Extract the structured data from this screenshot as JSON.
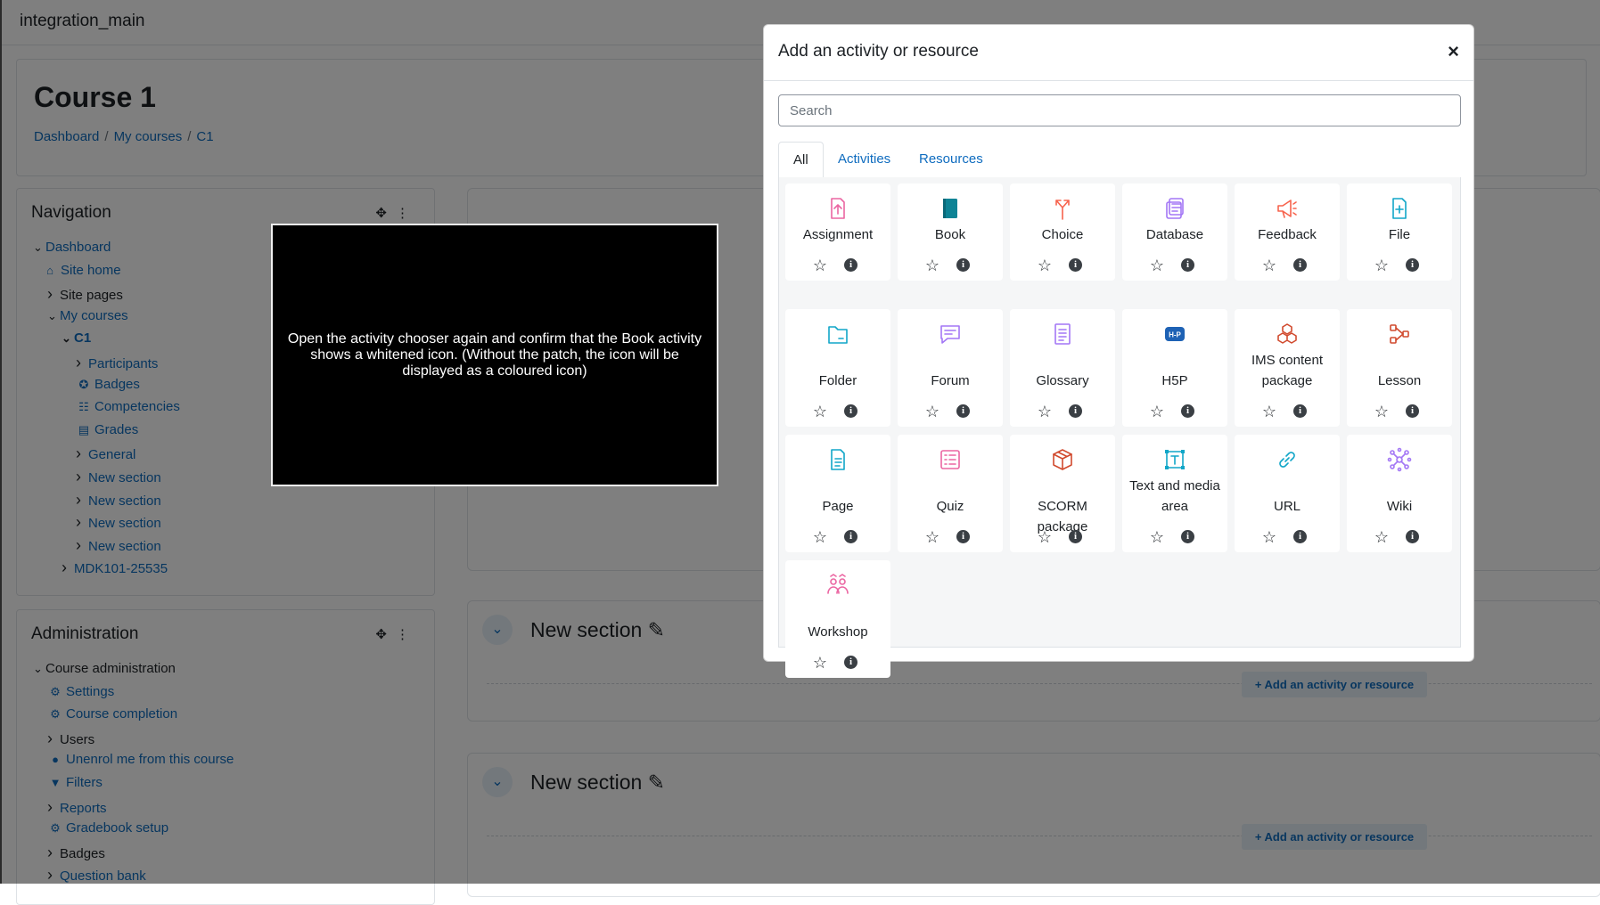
{
  "site": {
    "name": "integration_main"
  },
  "course": {
    "title": "Course 1",
    "breadcrumb": [
      "Dashboard",
      "My courses",
      "C1"
    ]
  },
  "navigation": {
    "title": "Navigation",
    "items": [
      {
        "label": "Dashboard",
        "icon": "chevron-down-icon"
      },
      {
        "label": "Site home",
        "icon": "home-icon"
      },
      {
        "label": "Site pages",
        "icon": "chevron-right-icon"
      },
      {
        "label": "My courses",
        "icon": "chevron-down-icon"
      },
      {
        "label": "C1",
        "icon": "chevron-down-icon"
      },
      {
        "label": "Participants",
        "icon": "chevron-right-icon"
      },
      {
        "label": "Badges",
        "icon": "badge-icon"
      },
      {
        "label": "Competencies",
        "icon": "list-check-icon"
      },
      {
        "label": "Grades",
        "icon": "clipboard-icon"
      },
      {
        "label": "General",
        "icon": "chevron-right-icon"
      },
      {
        "label": "New section",
        "icon": "chevron-right-icon"
      },
      {
        "label": "New section",
        "icon": "chevron-right-icon"
      },
      {
        "label": "New section",
        "icon": "chevron-right-icon"
      },
      {
        "label": "New section",
        "icon": "chevron-right-icon"
      },
      {
        "label": "MDK101-25535",
        "icon": "chevron-right-icon"
      }
    ]
  },
  "administration": {
    "title": "Administration",
    "items": [
      {
        "label": "Course administration",
        "icon": "chevron-down-icon"
      },
      {
        "label": "Settings",
        "icon": "gear-icon"
      },
      {
        "label": "Course completion",
        "icon": "gear-icon"
      },
      {
        "label": "Users",
        "icon": "chevron-right-icon"
      },
      {
        "label": "Unenrol me from this course",
        "icon": "user-icon"
      },
      {
        "label": "Filters",
        "icon": "filter-icon"
      },
      {
        "label": "Reports",
        "icon": "chevron-right-icon"
      },
      {
        "label": "Gradebook setup",
        "icon": "gear-icon"
      },
      {
        "label": "Badges",
        "icon": "chevron-right-icon"
      },
      {
        "label": "Question bank",
        "icon": "chevron-right-icon"
      }
    ]
  },
  "sections": [
    {
      "title": "New section",
      "add_label": "Add an activity or resource"
    },
    {
      "title": "New section",
      "add_label": "Add an activity or resource"
    }
  ],
  "instruction": {
    "text": "Open the activity chooser again and confirm that the Book activity shows a whitened icon. (Without the patch, the icon will be displayed as a coloured icon)"
  },
  "modal": {
    "title": "Add an activity or resource",
    "close_label": "×",
    "search_placeholder": "Search",
    "tabs": [
      "All",
      "Activities",
      "Resources"
    ],
    "active_tab": "All",
    "activities": [
      {
        "label": "Assignment",
        "icon": "assignment-icon",
        "color": "#eb66a2"
      },
      {
        "label": "Book",
        "icon": "book-icon",
        "color": "#0d8395"
      },
      {
        "label": "Choice",
        "icon": "choice-icon",
        "color": "#f7634d"
      },
      {
        "label": "Database",
        "icon": "database-icon",
        "color": "#a377f5"
      },
      {
        "label": "Feedback",
        "icon": "feedback-icon",
        "color": "#f7634d"
      },
      {
        "label": "File",
        "icon": "file-icon",
        "color": "#11a6c8"
      },
      {
        "label": "Folder",
        "icon": "folder-icon",
        "color": "#11a6c8"
      },
      {
        "label": "Forum",
        "icon": "forum-icon",
        "color": "#a377f5"
      },
      {
        "label": "Glossary",
        "icon": "glossary-icon",
        "color": "#a377f5"
      },
      {
        "label": "H5P",
        "icon": "h5p-icon",
        "color": "#1e62b5"
      },
      {
        "label": "IMS content package",
        "icon": "ims-package-icon",
        "color": "#d14a2e"
      },
      {
        "label": "Lesson",
        "icon": "lesson-icon",
        "color": "#d14a2e"
      },
      {
        "label": "Page",
        "icon": "page-icon",
        "color": "#11a6c8"
      },
      {
        "label": "Quiz",
        "icon": "quiz-icon",
        "color": "#eb66a2"
      },
      {
        "label": "SCORM package",
        "icon": "scorm-icon",
        "color": "#d14a2e"
      },
      {
        "label": "Text and media area",
        "icon": "text-media-icon",
        "color": "#11a6c8"
      },
      {
        "label": "URL",
        "icon": "url-icon",
        "color": "#11a6c8"
      },
      {
        "label": "Wiki",
        "icon": "wiki-icon",
        "color": "#a377f5"
      },
      {
        "label": "Workshop",
        "icon": "workshop-icon",
        "color": "#eb66a2"
      }
    ]
  }
}
